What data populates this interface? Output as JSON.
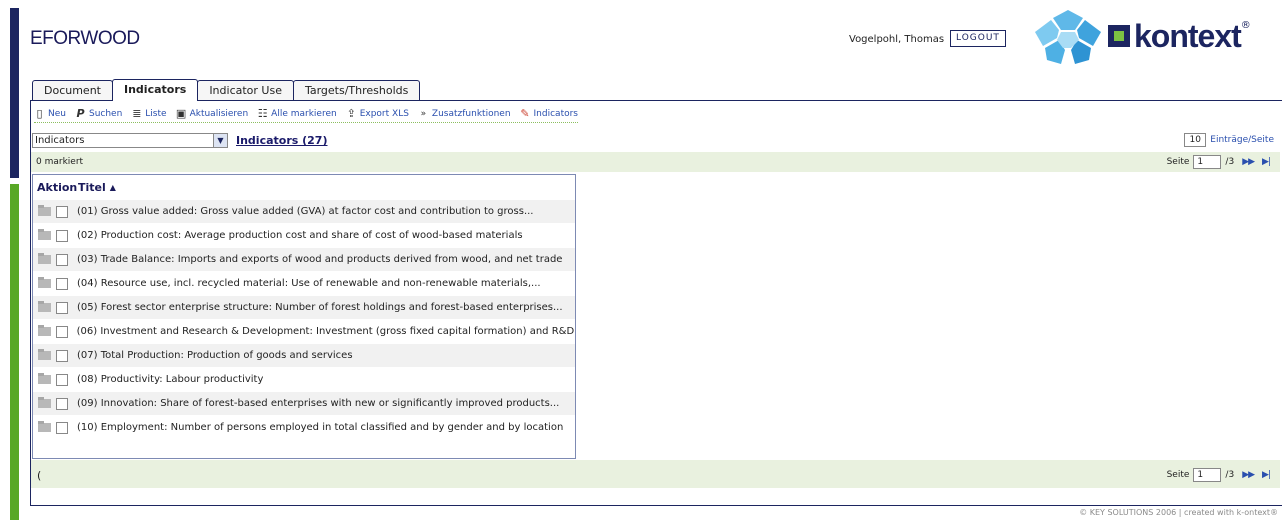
{
  "header": {
    "app_title": "EFORWOOD",
    "user": "Vogelpohl, Thomas",
    "logout": "LOGOUT",
    "brand": "kontext",
    "brand_reg": "®"
  },
  "tabs": [
    {
      "label": "Document"
    },
    {
      "label": "Indicators"
    },
    {
      "label": "Indicator Use"
    },
    {
      "label": "Targets/Thresholds"
    }
  ],
  "toolbar": {
    "neu": "Neu",
    "suchen": "Suchen",
    "liste": "Liste",
    "aktualisieren": "Aktualisieren",
    "alle_markieren": "Alle markieren",
    "export": "Export XLS",
    "zusatz": "Zusatzfunktionen",
    "indicators": "Indicators"
  },
  "select": {
    "value": "Indicators",
    "link": "Indicators (27)"
  },
  "per_page": {
    "value": "10",
    "label": "Einträge/Seite"
  },
  "band": {
    "marked": "0 markiert",
    "seite": "Seite",
    "page": "1",
    "total": "/3",
    "paren": "("
  },
  "table": {
    "col_action": "Aktion",
    "col_title": "Titel",
    "sort_icon": "▲",
    "rows": [
      "(01) Gross value added: Gross value added (GVA) at factor cost and contribution to gross...",
      "(02) Production cost: Average production cost and share of cost of wood-based materials",
      "(03) Trade Balance: Imports and exports of wood and products derived from wood, and net trade",
      "(04) Resource use, incl. recycled material: Use of renewable and non-renewable materials,...",
      "(05) Forest sector enterprise structure: Number of forest holdings and forest-based enterprises...",
      "(06) Investment and Research & Development: Investment (gross fixed capital formation) and R&D...",
      "(07) Total Production: Production of goods and services",
      "(08) Productivity: Labour productivity",
      "(09) Innovation: Share of forest-based enterprises with new or significantly improved products...",
      "(10) Employment: Number of persons employed in total classified and by gender and by location"
    ]
  },
  "footer": "© KEY SOLUTIONS 2006 | created with k-ontext®"
}
